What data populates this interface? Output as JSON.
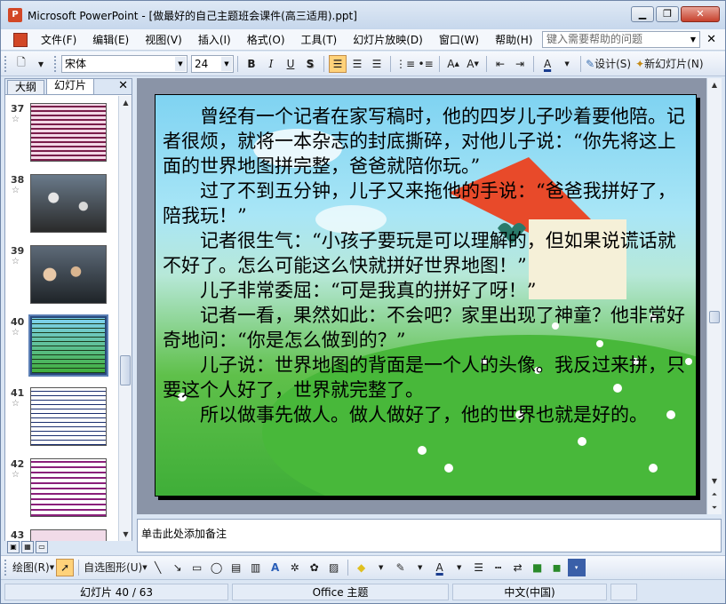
{
  "window": {
    "title": "Microsoft PowerPoint - [做最好的自己主题班会课件(高三适用).ppt]"
  },
  "menu": {
    "items": [
      "文件(F)",
      "编辑(E)",
      "视图(V)",
      "插入(I)",
      "格式(O)",
      "工具(T)",
      "幻灯片放映(D)",
      "窗口(W)",
      "帮助(H)"
    ],
    "help_placeholder": "键入需要帮助的问题"
  },
  "toolbar": {
    "font": "宋体",
    "size": "24",
    "bold": "B",
    "italic": "I",
    "underline": "U",
    "shadow": "S",
    "design_label": "设计(S)",
    "new_slide_label": "新幻灯片(N)"
  },
  "pane": {
    "tabs": [
      "大纲",
      "幻灯片"
    ],
    "selected_tab": 1
  },
  "thumbs": [
    {
      "num": "37",
      "star": "☆"
    },
    {
      "num": "38",
      "star": "☆"
    },
    {
      "num": "39",
      "star": "☆"
    },
    {
      "num": "40",
      "star": "☆"
    },
    {
      "num": "41",
      "star": "☆"
    },
    {
      "num": "42",
      "star": "☆"
    },
    {
      "num": "43",
      "star": ""
    }
  ],
  "slide": {
    "paragraphs": [
      "　　曾经有一个记者在家写稿时，他的四岁儿子吵着要他陪。记者很烦，就将一本杂志的封底撕碎，对他儿子说：“你先将这上面的世界地图拼完整，爸爸就陪你玩。”",
      "　　过了不到五分钟，儿子又来拖他的手说：“爸爸我拼好了，陪我玩！”",
      "　　记者很生气：“小孩子要玩是可以理解的，但如果说谎话就不好了。怎么可能这么快就拼好世界地图！”",
      "　　儿子非常委屈：“可是我真的拼好了呀！”",
      "　　记者一看，果然如此：不会吧？家里出现了神童？他非常好奇地问：“你是怎么做到的？”",
      "　　儿子说：世界地图的背面是一个人的头像。我反过来拼，只要这个人好了，世界就完整了。",
      "　　所以做事先做人。做人做好了，他的世界也就是好的。"
    ]
  },
  "notes": {
    "placeholder": "单击此处添加备注"
  },
  "drawbar": {
    "draw_label": "绘图(R)",
    "autoshape_label": "自选图形(U)"
  },
  "status": {
    "slide": "幻灯片 40 / 63",
    "theme": "Office 主题",
    "lang": "中文(中国)"
  }
}
